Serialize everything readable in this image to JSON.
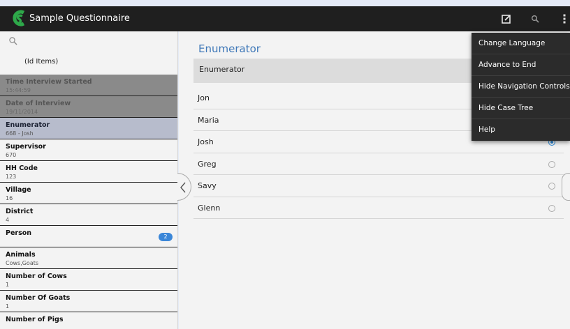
{
  "app": {
    "title": "Sample Questionnaire"
  },
  "icons": {
    "logo": "cs-logo-icon",
    "notes": "note-edit-icon",
    "search": "search-icon",
    "overflow": "overflow-menu-icon",
    "prev": "chevron-left-icon"
  },
  "colors": {
    "accent": "#3f78b8",
    "badge": "#3a86d8",
    "radio_selected": "#2d8ad8",
    "appbar": "#1f1f1f"
  },
  "sidebar": {
    "header": "(Id Items)",
    "items": [
      {
        "label": "Time Interview Started",
        "value": "15:44:59",
        "state": "disabled"
      },
      {
        "label": "Date of Interview",
        "value": "19/11/2014",
        "state": "disabled"
      },
      {
        "label": "Enumerator",
        "value": "668 - Josh",
        "state": "current"
      },
      {
        "label": "Supervisor",
        "value": "670",
        "state": "normal"
      },
      {
        "label": "HH Code",
        "value": "123",
        "state": "normal"
      },
      {
        "label": "Village",
        "value": "16",
        "state": "normal"
      },
      {
        "label": "District",
        "value": "4",
        "state": "normal"
      },
      {
        "label": "Person",
        "value": "",
        "badge": "2",
        "state": "normal"
      },
      {
        "label": "Animals",
        "value": "Cows,Goats",
        "state": "normal"
      },
      {
        "label": "Number of Cows",
        "value": "1",
        "state": "normal"
      },
      {
        "label": "Number Of Goats",
        "value": "1",
        "state": "normal"
      },
      {
        "label": "Number of Pigs",
        "value": "",
        "state": "normal"
      }
    ]
  },
  "question": {
    "title": "Enumerator",
    "text": "Enumerator",
    "options": [
      {
        "label": "Jon",
        "selected": false
      },
      {
        "label": "Maria",
        "selected": false
      },
      {
        "label": "Josh",
        "selected": true
      },
      {
        "label": "Greg",
        "selected": false
      },
      {
        "label": "Savy",
        "selected": false
      },
      {
        "label": "Glenn",
        "selected": false
      }
    ]
  },
  "menu": {
    "items": [
      {
        "label": "Change Language"
      },
      {
        "label": "Advance to End"
      },
      {
        "label": "Hide Navigation Controls"
      },
      {
        "label": "Hide Case Tree"
      },
      {
        "label": "Help"
      }
    ]
  }
}
